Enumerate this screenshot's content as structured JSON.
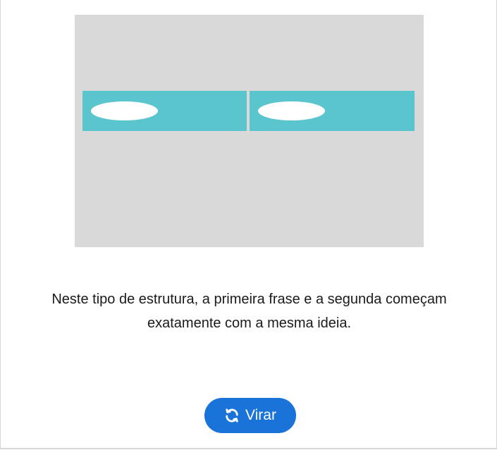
{
  "card": {
    "caption": "Neste tipo de estrutura, a primeira frase e a segunda começam exatamente com a mesma ideia."
  },
  "illustration": {
    "colors": {
      "panel": "#d9d9d9",
      "bar": "#5bc5ce",
      "oval": "#ffffff"
    }
  },
  "actions": {
    "flip_label": "Virar",
    "flip_icon": "sync-icon",
    "button_color": "#1a73d9"
  }
}
